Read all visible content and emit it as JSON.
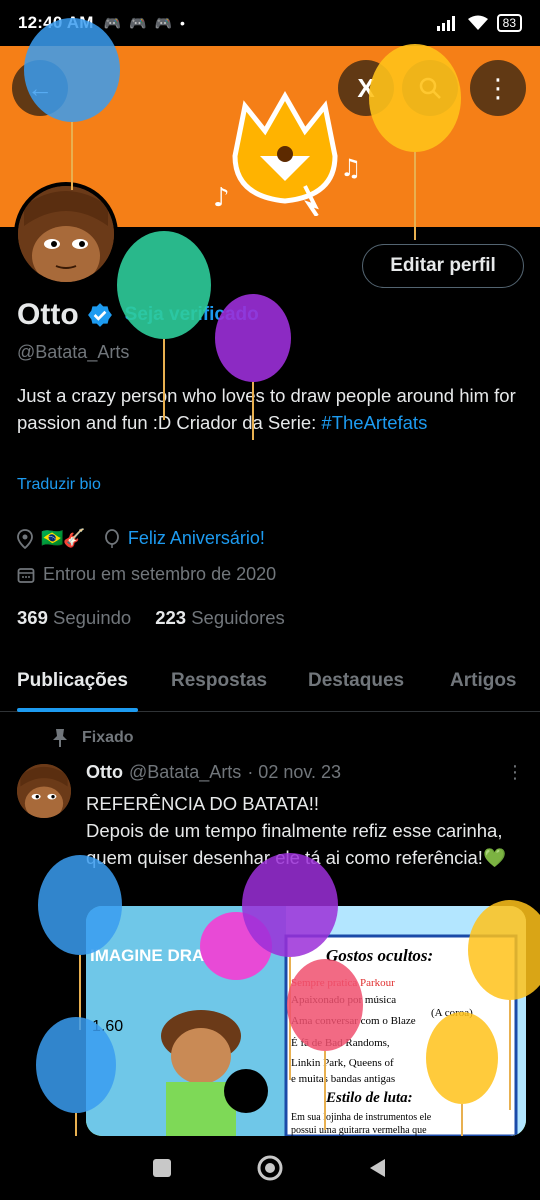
{
  "status": {
    "time": "12:40 AM",
    "battery": "83"
  },
  "profile": {
    "name": "Otto",
    "get_verified": "Seja verificado",
    "handle": "@Batata_Arts",
    "bio_text": "Just a crazy person who loves to draw people around him for passion and fun :D  Criador da Serie: ",
    "bio_tag": "#TheArtefats",
    "translate": "Traduzir bio",
    "location_flags": "🇧🇷🎸",
    "birthday_link": "Feliz Aniversário!",
    "joined": "Entrou em setembro de 2020",
    "following_count": "369",
    "following_label": "Seguindo",
    "followers_count": "223",
    "followers_label": "Seguidores",
    "edit_label": "Editar perfil"
  },
  "tabs": [
    "Publicações",
    "Respostas",
    "Destaques",
    "Artigos"
  ],
  "pinned_label": "Fixado",
  "tweet": {
    "name": "Otto",
    "handle": "@Batata_Arts",
    "date": "· 02 nov. 23",
    "more": "⋮",
    "text": "REFERÊNCIA DO BATATA!!\n Depois de um tempo finalmente refiz esse carinha, quem quiser desenhar ele tá ai como referência!💚",
    "media": {
      "band_name": "IMAGINE DRAGONS",
      "height_label": "1.60",
      "card_title": "Gostos ocultos:",
      "lines": [
        "Sempre pratica Parkour",
        "Apaixonado por música",
        "(A coroa)",
        "Ama conversar com o Blaze",
        "É fã de Bad Randoms,",
        "Linkin Park, Queens of",
        "e muitas bandas antigas",
        "Estilo de luta:",
        "Em sua lojinha de instrumentos ele",
        "possui uma guitarra vermelha que"
      ]
    }
  },
  "colors": {
    "accent": "#1d9bf0",
    "banner": "#f57f17",
    "bg": "#000000"
  }
}
